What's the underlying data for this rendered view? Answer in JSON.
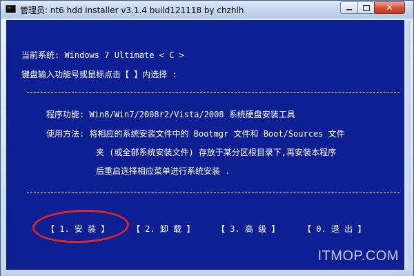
{
  "window": {
    "title": "管理员:  nt6 hdd installer v3.1.4 build121118 by chzhlh"
  },
  "caption_buttons": {
    "min_icon": "minimize-icon",
    "max_icon": "maximize-icon",
    "close_label": "✕"
  },
  "console": {
    "current_system": "当前系统: Windows 7 Ultimate  < C >",
    "prompt": "键盘输入功能号或鼠标点击【 】内选择 :",
    "separator": "--------------------------------------------------------------------------------------------------------",
    "function_line": "程序功能:  Win8/Win7/2008r2/Vista/2008 系统硬盘安装工具",
    "usage_line_1": "使用方法: 将相应的系统安装文件中的 Bootmgr 文件和 Boot/Sources 文件",
    "usage_line_2": "夹 (或全部系统安装文件) 存放于某分区根目录下,再安装本程序",
    "usage_line_3": "后重启选择相应菜单进行系统安装 .",
    "menu": [
      {
        "label": "【 1. 安 装  】"
      },
      {
        "label": "【 2. 卸 载  】"
      },
      {
        "label": "【 3. 高 级  】"
      },
      {
        "label": "【 0. 退 出  】"
      }
    ]
  },
  "watermark": "ITMOP.COM",
  "colors": {
    "console_bg": "#0e1f93",
    "console_text": "#ffffff",
    "highlight": "#d9262a"
  }
}
